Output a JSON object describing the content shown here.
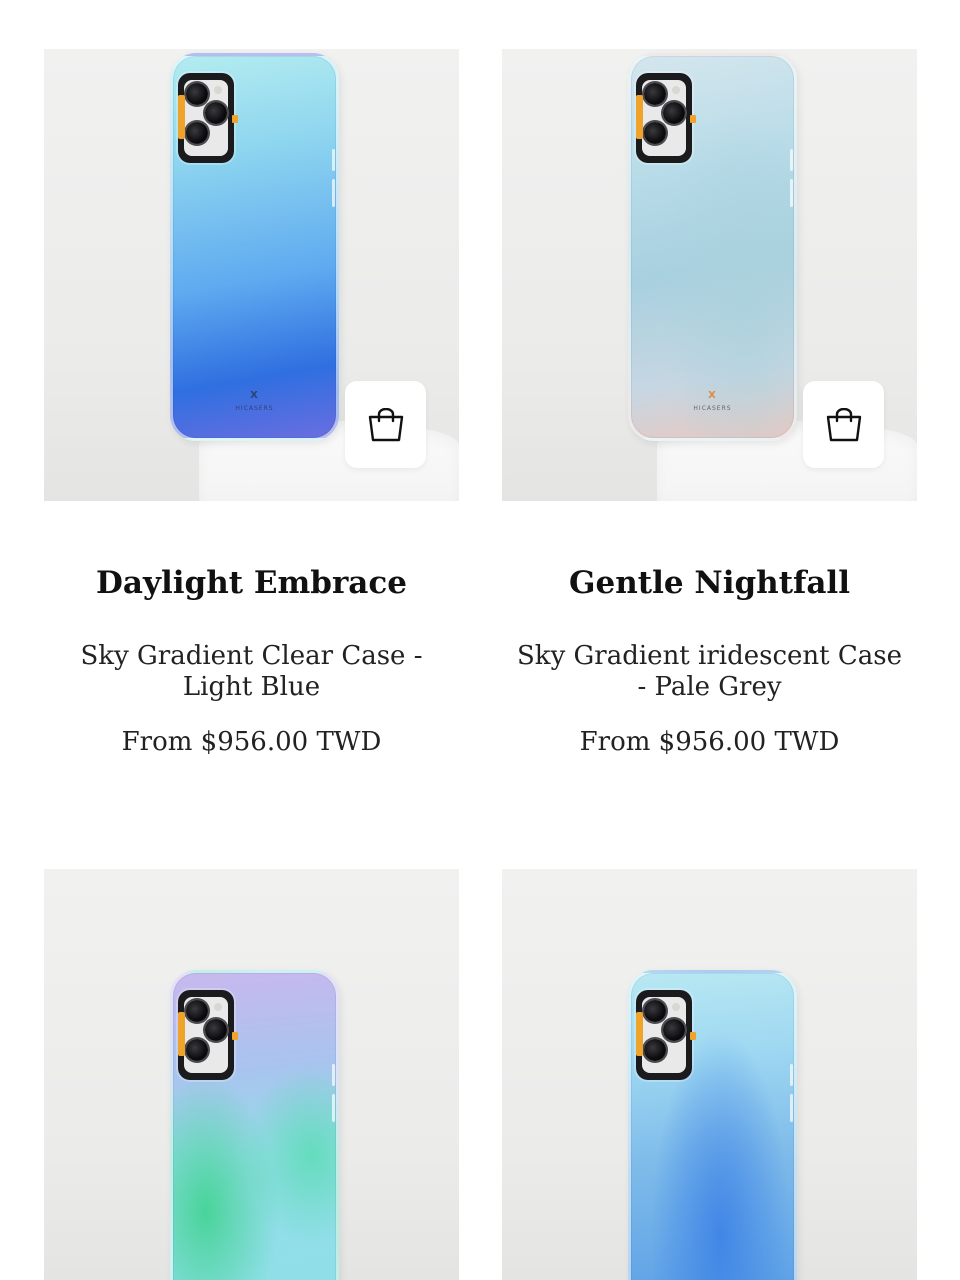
{
  "products": [
    {
      "title": "Daylight Embrace",
      "variant": "Sky Gradient Clear Case - Light Blue",
      "price": "From $956.00 TWD",
      "brand": "HICASERS",
      "image_colors": [
        "#b4ecf0",
        "#5faaf0",
        "#2f6fe0"
      ],
      "icon": "shopping-bag-icon"
    },
    {
      "title": "Gentle Nightfall",
      "variant": "Sky Gradient iridescent Case - Pale Grey",
      "price": "From $956.00 TWD",
      "brand": "HICASERS",
      "image_colors": [
        "#d4e6ee",
        "#a8d0df",
        "#e8c8c0"
      ],
      "icon": "shopping-bag-icon"
    },
    {
      "image_colors": [
        "#c8b8ee",
        "#96dcea",
        "#3cd28c"
      ]
    },
    {
      "image_colors": [
        "#b8e8f2",
        "#7fbcea",
        "#3c82e6"
      ]
    }
  ]
}
